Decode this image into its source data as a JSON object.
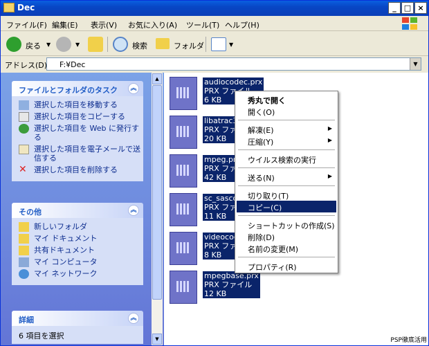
{
  "window": {
    "title": "Dec"
  },
  "menubar": {
    "items": [
      "ファイル(F)",
      "編集(E)",
      "表示(V)",
      "お気に入り(A)",
      "ツール(T)",
      "ヘルプ(H)"
    ]
  },
  "toolbar": {
    "back": "戻る",
    "search": "検索",
    "folders": "フォルダ"
  },
  "address": {
    "label": "アドレス(D)",
    "value": "F:¥Dec"
  },
  "tasks_panel": {
    "title": "ファイルとフォルダのタスク",
    "items": [
      "選択した項目を移動する",
      "選択した項目をコピーする",
      "選択した項目を Web に発行する",
      "選択した項目を電子メールで送信する",
      "選択した項目を削除する"
    ]
  },
  "other_panel": {
    "title": "その他",
    "items": [
      "新しいフォルダ",
      "マイ ドキュメント",
      "共有ドキュメント",
      "マイ コンピュータ",
      "マイ ネットワーク"
    ]
  },
  "details_panel": {
    "title": "詳細",
    "text": "6 項目を選択"
  },
  "files": [
    {
      "name": "audiocodec.prx",
      "type": "PRX ファイル",
      "size": "6 KB"
    },
    {
      "name": "libatrac3p",
      "type": "PRX ファイル",
      "size": "20 KB"
    },
    {
      "name": "mpeg.prx",
      "type": "PRX ファイル",
      "size": "42 KB"
    },
    {
      "name": "sc_sascore",
      "type": "PRX ファイル",
      "size": "11 KB"
    },
    {
      "name": "videocodec",
      "type": "PRX ファイル",
      "size": "8 KB"
    },
    {
      "name": "mpegbase.prx",
      "type": "PRX ファイル",
      "size": "12 KB"
    }
  ],
  "context_menu": {
    "open_with": "秀丸で開く",
    "open": "開く(O)",
    "extract": "解凍(E)",
    "compress": "圧縮(Y)",
    "virus_scan": "ウイルス検索の実行",
    "send_to": "送る(N)",
    "cut": "切り取り(T)",
    "copy": "コピー(C)",
    "create_shortcut": "ショートカットの作成(S)",
    "delete": "削除(D)",
    "rename": "名前の変更(M)",
    "properties": "プロパティ(R)"
  },
  "watermark": "PSP徹底活用",
  "colors": {
    "selection": "#0a246a",
    "titlebar": "#0846c5",
    "taskpane": "#6375d6"
  }
}
